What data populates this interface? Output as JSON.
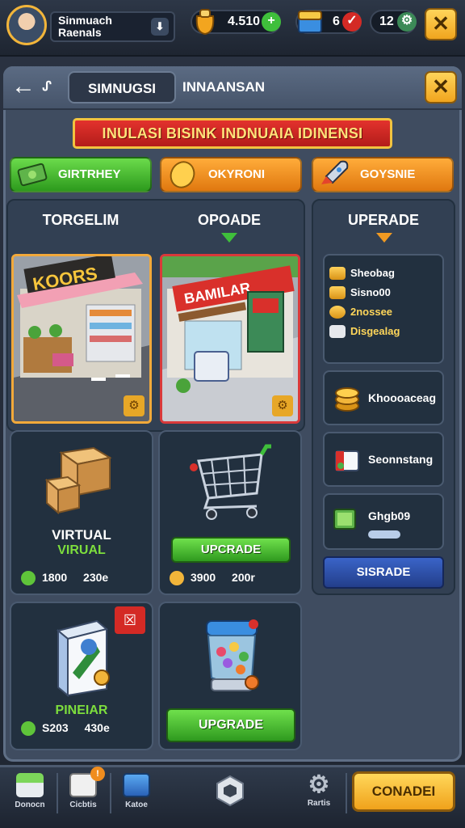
{
  "player": {
    "line1": "Sinmuach",
    "line2": "Raenals"
  },
  "resources": [
    {
      "value": "4.510",
      "icon": "potion-bag-icon",
      "plus": "+"
    },
    {
      "value": "6",
      "icon": "treasure-chest-icon",
      "plus": "✓"
    },
    {
      "value": "12",
      "icon": "gem-icon",
      "plus": "⚙"
    }
  ],
  "header": {
    "back_label": "←",
    "tab_active": "SIMNUGSI",
    "tab_title": "INNAANSAN",
    "close_label": "✕"
  },
  "banner": {
    "text": "INULASI BISINK INDNUAIA IDINENSI"
  },
  "categories": [
    {
      "label": "GIRTRHEY",
      "color": "#48c83a"
    },
    {
      "label": "OKYRONI",
      "color": "#f08d1e"
    },
    {
      "label": "GOYSNIE",
      "color": "#f08d1e"
    }
  ],
  "columns": {
    "left_title": "TORGELIM",
    "mid_title": "OPOADE",
    "right_title": "UPERADE"
  },
  "shops": [
    {
      "sign": "KOORS",
      "badge": "⚙"
    },
    {
      "sign": "BAMILAR",
      "badge": "⚙"
    }
  ],
  "cards": [
    {
      "title": "VIRTUAL",
      "sub": "VIRUAL",
      "price": "1800",
      "extra": "230e"
    },
    {
      "price": "3900",
      "extra": "200r",
      "button": "UPCRADE"
    },
    {
      "title": "PINEIAR",
      "price": "S203",
      "extra": "430e"
    },
    {
      "button": "UPGRADE"
    }
  ],
  "side_list": [
    {
      "label": "Sheobag"
    },
    {
      "label": "Sisno00"
    },
    {
      "label": "2nossee"
    },
    {
      "label": "Disgealag"
    }
  ],
  "side_items": [
    {
      "label": "Khoooaceag"
    },
    {
      "label": "Seonnstang"
    },
    {
      "label": "Ghgb09"
    }
  ],
  "side_button": "SISRADE",
  "nav": [
    {
      "label": "Donocn",
      "icon": "house-icon"
    },
    {
      "label": "Cicbtis",
      "icon": "dice-icon",
      "badge": "!"
    },
    {
      "label": "Katoe",
      "icon": "box-icon"
    },
    {
      "label": "",
      "icon": "hexagon-icon"
    },
    {
      "label": "Rartis",
      "icon": "gear-icon"
    }
  ],
  "cta_label": "CONADEI",
  "colors": {
    "accent": "#f2b53a",
    "green": "#48c83a",
    "orange": "#f08d1e",
    "red": "#d42a25",
    "blue": "#2c4ea8"
  }
}
